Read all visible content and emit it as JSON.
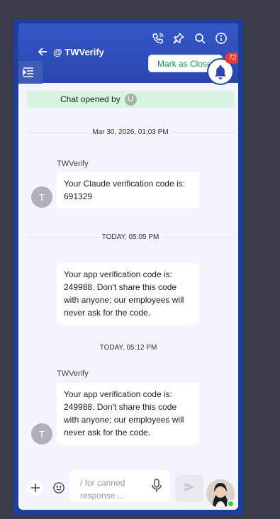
{
  "header": {
    "title": "@ TWVerify",
    "icons": [
      "phone-icon",
      "pin-icon",
      "search-icon",
      "info-icon"
    ],
    "mark_closed_label": "Mark as Closed",
    "notifications_count": "72"
  },
  "chat_opened": {
    "text": "Chat opened by",
    "avatar_letter": "U"
  },
  "messages": [
    {
      "date": "Mar 30, 2026, 01:03 PM",
      "sender": "TWVerify",
      "avatar_letter": "T",
      "text": "Your Claude verification code is: 691329"
    },
    {
      "date": "TODAY, 05:05 PM",
      "text": "Your app verification code is: 249988. Don't share this code with anyone; our employees will never ask for the code."
    },
    {
      "date": "TODAY, 05:12 PM",
      "sender": "TWVerify",
      "avatar_letter": "T",
      "text": "Your app verification code is: 249988. Don't share this code with anyone; our employees will never ask for the code."
    }
  ],
  "composer": {
    "placeholder": "/ for canned response ...",
    "icons": [
      "plus-icon",
      "emoji-icon",
      "mic-icon",
      "send-icon"
    ]
  },
  "colors": {
    "header": "#2a46ad",
    "accent_green": "#1a9a4b",
    "badge": "#e53935",
    "online": "#2ecc40"
  }
}
